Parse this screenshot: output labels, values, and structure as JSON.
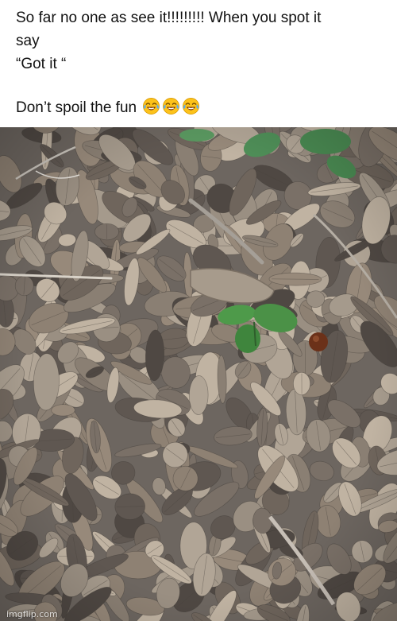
{
  "caption": {
    "line1": "So far no  one as see it!!!!!!!!! When you spot it",
    "line2": "say",
    "line3": "“Got it “",
    "line4": "Don’t spoil the fun",
    "emojis": [
      "tears-of-joy-emoji",
      "tears-of-joy-emoji",
      "tears-of-joy-emoji"
    ]
  },
  "photo": {
    "subject": "forest-floor-leaf-litter",
    "watermark": "imgflip.com"
  },
  "colors": {
    "caption_bg": "#ffffff",
    "caption_text": "#111111",
    "emoji_face": "#fcc21b",
    "emoji_tear": "#5aa9f0"
  }
}
